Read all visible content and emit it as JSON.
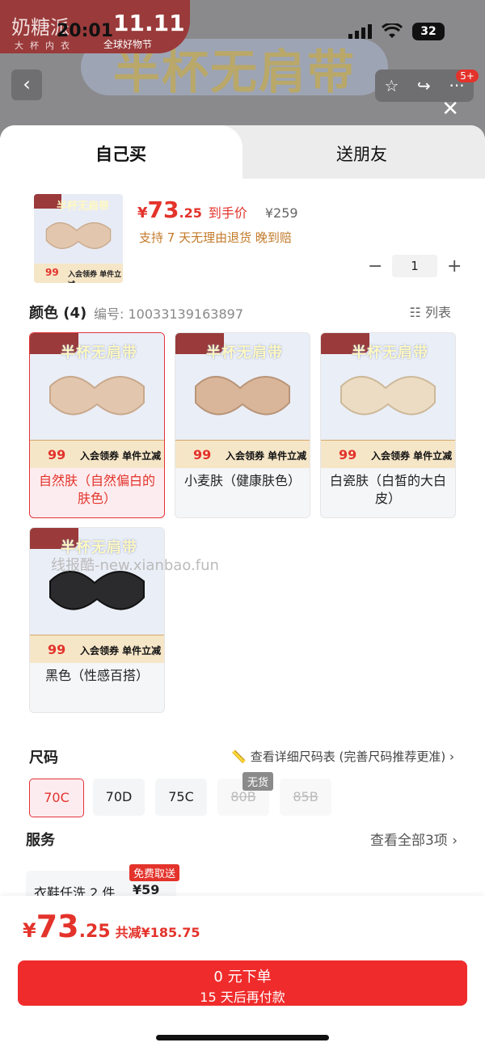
{
  "status_bar": {
    "time": "20:01",
    "battery": "32"
  },
  "background": {
    "brand_name": "奶糖派",
    "brand_sub": "大杯内衣",
    "event_logo": "11.11",
    "event_name": "全球好物节",
    "banner_text": "半杯无肩带"
  },
  "top_bar": {
    "back_icon": "‹",
    "notification_badge": "5+",
    "close_icon": "✕"
  },
  "tabs": [
    {
      "label": "自己买",
      "active": true
    },
    {
      "label": "送朋友",
      "active": false
    }
  ],
  "product": {
    "price_currency": "¥",
    "price_int": "73",
    "price_dec": ".25",
    "price_tag": "到手价",
    "original_price": "¥259",
    "promise": "支持 7 天无理由退货   晚到赔",
    "quantity": "1",
    "thumb_banner": "半杯无肩带",
    "thumb_price": "99",
    "thumb_strip": "入会领券 单件立减"
  },
  "color_section": {
    "title": "颜色 (4)",
    "code": "编号: 10033139163897",
    "list_toggle": "列表",
    "options": [
      {
        "label": "自然肤（自然偏白的肤色）",
        "selected": true,
        "tone": "#e2c7ae"
      },
      {
        "label": "小麦肤（健康肤色）",
        "selected": false,
        "tone": "#d9b69a"
      },
      {
        "label": "白瓷肤（白皙的大白皮）",
        "selected": false,
        "tone": "#ecdcc3"
      },
      {
        "label": "黑色（性感百搭）",
        "selected": false,
        "tone": "#2b2b2d"
      }
    ],
    "card_banner": "半杯无肩带",
    "card_price": "99",
    "card_strip": "入会领券 单件立减"
  },
  "watermark": "线报酷-new.xianbao.fun",
  "size_section": {
    "title": "尺码",
    "link": "查看详细尺码表 (完善尺码推荐更准)",
    "out_of_stock": "无货",
    "sizes": [
      {
        "label": "70C",
        "state": "selected"
      },
      {
        "label": "70D",
        "state": "normal"
      },
      {
        "label": "75C",
        "state": "normal"
      },
      {
        "label": "80B",
        "state": "disabled"
      },
      {
        "label": "85B",
        "state": "disabled"
      }
    ]
  },
  "service_section": {
    "title": "服务",
    "link": "查看全部3项",
    "item_name": "衣鞋任洗 2 件",
    "item_price": "¥59",
    "item_badge": "免费取送"
  },
  "footer": {
    "price_currency": "¥",
    "price_int": "73",
    "price_dec": ".25",
    "saved": "共减¥185.75",
    "button_line1": "0 元下单",
    "button_line2": "15 天后再付款"
  }
}
